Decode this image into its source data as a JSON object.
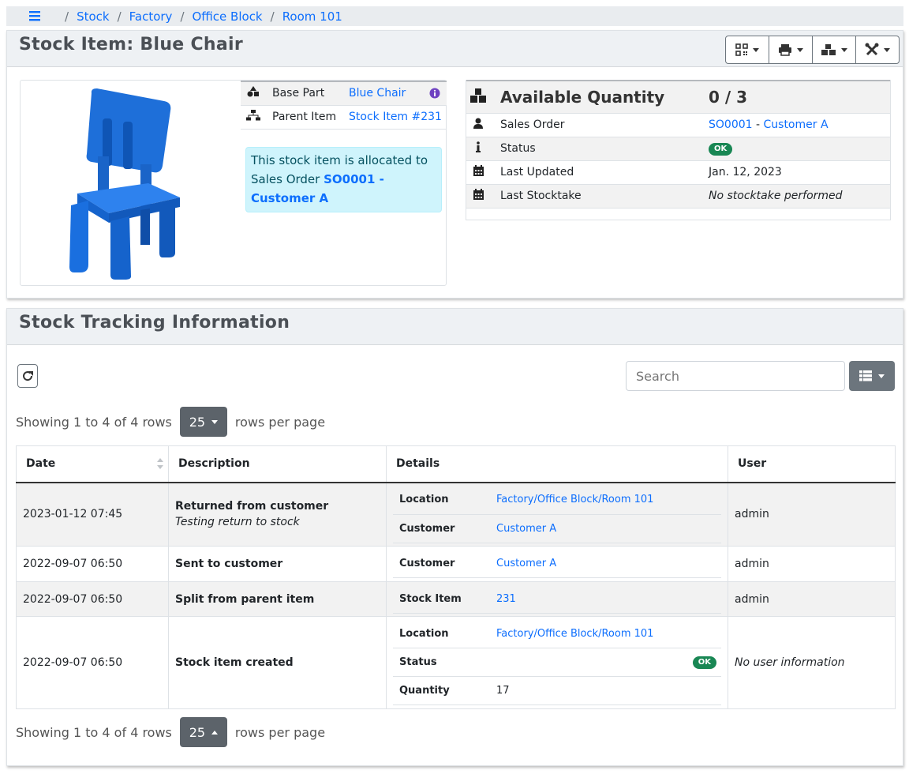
{
  "breadcrumb": {
    "items": [
      "Stock",
      "Factory",
      "Office Block",
      "Room 101"
    ]
  },
  "item_panel": {
    "title": "Stock Item: Blue Chair",
    "info": {
      "base_part_label": "Base Part",
      "base_part_value": "Blue Chair",
      "parent_item_label": "Parent Item",
      "parent_item_value": "Stock Item #231"
    },
    "allocation": {
      "text": "This stock item is allocated to Sales Order ",
      "link": "SO0001 - Customer A"
    },
    "quantity": {
      "label": "Available Quantity",
      "value": "0 / 3",
      "rows": [
        {
          "label": "Sales Order",
          "so_link": "SO0001",
          "sep": " - ",
          "customer_link": "Customer A"
        },
        {
          "label": "Status",
          "badge": "OK"
        },
        {
          "label": "Last Updated",
          "value": "Jan. 12, 2023"
        },
        {
          "label": "Last Stocktake",
          "value": "No stocktake performed"
        }
      ]
    }
  },
  "tracking_panel": {
    "title": "Stock Tracking Information",
    "search_placeholder": "Search",
    "pagination": {
      "summary": "Showing 1 to 4 of 4 rows",
      "page_size": "25",
      "suffix": "rows per page"
    },
    "columns": [
      "Date",
      "Description",
      "Details",
      "User"
    ],
    "rows": [
      {
        "date": "2023-01-12 07:45",
        "title": "Returned from customer",
        "subtitle": "Testing return to stock",
        "details": [
          {
            "key": "Location",
            "value": "Factory/Office Block/Room 101"
          },
          {
            "key": "Customer",
            "value": "Customer A"
          }
        ],
        "user": "admin"
      },
      {
        "date": "2022-09-07 06:50",
        "title": "Sent to customer",
        "details": [
          {
            "key": "Customer",
            "value": "Customer A"
          }
        ],
        "user": "admin"
      },
      {
        "date": "2022-09-07 06:50",
        "title": "Split from parent item",
        "details": [
          {
            "key": "Stock Item",
            "value": "231"
          }
        ],
        "user": "admin"
      },
      {
        "date": "2022-09-07 06:50",
        "title": "Stock item created",
        "details": [
          {
            "key": "Location",
            "value": "Factory/Office Block/Room 101"
          },
          {
            "key": "Status",
            "badge": "OK"
          },
          {
            "key": "Quantity",
            "value": "17"
          }
        ],
        "user": "No user information"
      }
    ]
  },
  "colors": {
    "link": "#0d6efd",
    "ok_badge": "#198754",
    "alert_bg": "#cff4fc",
    "chair": "#1e6fd9"
  }
}
